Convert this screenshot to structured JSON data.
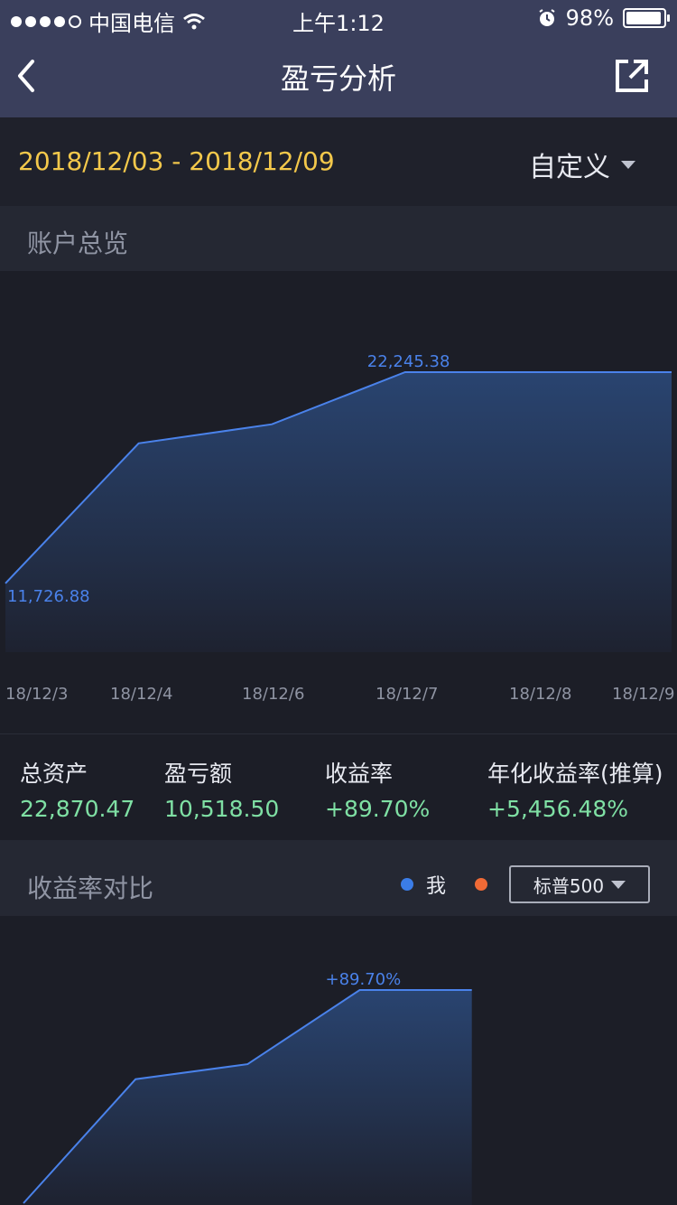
{
  "status_bar": {
    "carrier": "中国电信",
    "time": "上午1:12",
    "battery": "98%",
    "battery_level": 0.98
  },
  "nav": {
    "title": "盈亏分析"
  },
  "date_bar": {
    "range": "2018/12/03 - 2018/12/09",
    "mode": "自定义"
  },
  "overview": {
    "title": "账户总览"
  },
  "stats": [
    {
      "label": "总资产",
      "value": "22,870.47"
    },
    {
      "label": "盈亏额",
      "value": "10,518.50"
    },
    {
      "label": "收益率",
      "value": "+89.70%"
    },
    {
      "label": "年化收益率(推算)",
      "value": "+5,456.48%"
    }
  ],
  "compare": {
    "title": "收益率对比",
    "legend_me": "我",
    "benchmark": "标普500"
  },
  "colors": {
    "line": "#4a82ea",
    "me_dot": "#3b7de8",
    "bench_dot": "#f06a36",
    "positive": "#7fe0a4",
    "date": "#f3c84b"
  },
  "chart_data": [
    {
      "type": "area",
      "x": [
        "18/12/3",
        "18/12/4",
        "18/12/6",
        "18/12/7",
        "18/12/8",
        "18/12/9"
      ],
      "x_values": [
        3,
        4,
        5,
        6,
        7,
        8
      ],
      "values": [
        11726.88,
        18700,
        19650,
        22245.38,
        22245.38,
        22245.38
      ],
      "annotations": [
        {
          "x": 3,
          "text": "11,726.88"
        },
        {
          "x": 6,
          "text": "22,245.38"
        }
      ],
      "ylim": [
        11000,
        23000
      ],
      "xlim": [
        3,
        8
      ],
      "grid": false,
      "legend": "none"
    },
    {
      "type": "area",
      "x_values": [
        0,
        1,
        2,
        3,
        4
      ],
      "values": [
        -10,
        48,
        55,
        89.7,
        89.7
      ],
      "annotations": [
        {
          "x": 3,
          "text": "+89.70%"
        }
      ],
      "ylim": [
        -10,
        100
      ],
      "xlim": [
        0,
        5
      ],
      "grid": false,
      "legend": "top-right"
    }
  ]
}
